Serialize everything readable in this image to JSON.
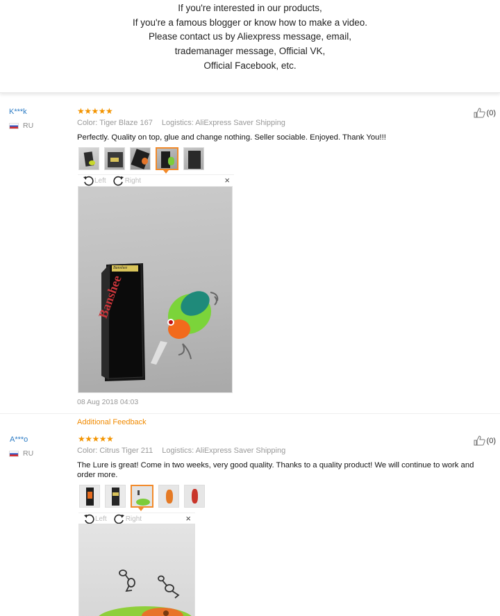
{
  "banner": {
    "lines": [
      "If you're interested in our products,",
      "If you're a famous blogger or know how to make a video.",
      "Please contact us by Aliexpress message, email,",
      "trademanager message, Official VK,",
      "Official Facebook, etc."
    ]
  },
  "reviews": [
    {
      "user": "K***k",
      "country": "RU",
      "stars": "★★★★★",
      "likes": "(0)",
      "color_label": "Color: Tiger Blaze 167",
      "logistics_label": "Logistics: AliExpress Saver Shipping",
      "text": "Perfectly. Quality on top, glue and change nothing. Seller sociable. Enjoyed. Thank You!!!",
      "viewer": {
        "left": "Left",
        "right": "Right",
        "close": "×"
      },
      "date": "08 Aug 2018 04:03",
      "box_brand": "Banshee",
      "box_small": "Banshee"
    },
    {
      "user": "A***o",
      "country": "RU",
      "stars": "★★★★★",
      "likes": "(0)",
      "color_label": "Color: Citrus Tiger 211",
      "logistics_label": "Logistics: AliExpress Saver Shipping",
      "text": "The Lure is great! Come in two weeks, very good quality. Thanks to a quality product! We will continue to work and order more.",
      "viewer": {
        "left": "Left",
        "right": "Right",
        "close": "×"
      }
    }
  ],
  "additional_feedback": "Additional Feedback",
  "colors": {
    "accent": "#f28a2a",
    "star": "#f39400",
    "username": "#2a7ac4"
  }
}
